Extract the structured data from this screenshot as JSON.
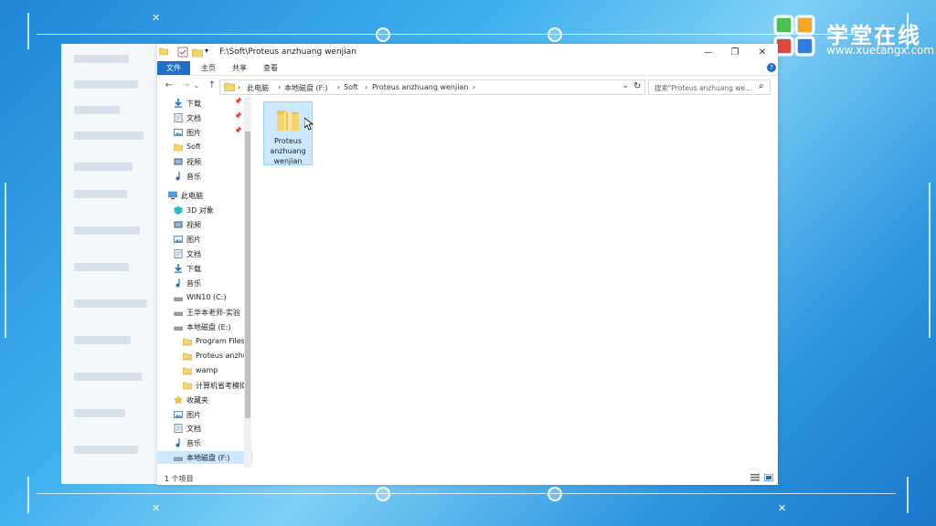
{
  "logo": {
    "name": "学堂在线",
    "url": "www.xuetangx.com"
  },
  "window": {
    "title_path": "F:\\Soft\\Proteus anzhuang  wenjian",
    "controls": {
      "minimize": "—",
      "maximize": "❐",
      "close": "✕"
    },
    "ribbon_tabs": [
      "文件",
      "主页",
      "共享",
      "查看"
    ],
    "help": "?",
    "nav": {
      "back": "←",
      "forward": "→",
      "recent": "⌄",
      "up": "↑",
      "dropdown": "⌄",
      "refresh": "↻"
    },
    "address": {
      "crumbs": [
        "此电脑",
        "本地磁盘 (F:)",
        "Soft",
        "Proteus anzhuang  wenjian"
      ],
      "sep": "›"
    },
    "search": {
      "placeholder": "搜索\"Proteus anzhuang  we...",
      "icon": "⌕"
    },
    "sidebar": [
      {
        "label": "下载",
        "icon": "download-icon",
        "pinned": true
      },
      {
        "label": "文档",
        "icon": "document-icon",
        "pinned": true
      },
      {
        "label": "图片",
        "icon": "picture-icon",
        "pinned": true
      },
      {
        "label": "Soft",
        "icon": "folder-icon",
        "pinned": false
      },
      {
        "label": "视频",
        "icon": "video-icon",
        "pinned": false
      },
      {
        "label": "音乐",
        "icon": "music-icon",
        "pinned": false
      },
      {
        "label": "此电脑",
        "icon": "pc-icon",
        "pinned": false
      },
      {
        "label": "3D 对象",
        "icon": "cube-icon",
        "pinned": false
      },
      {
        "label": "视频",
        "icon": "video-icon",
        "pinned": false
      },
      {
        "label": "图片",
        "icon": "picture-icon",
        "pinned": false
      },
      {
        "label": "文档",
        "icon": "document-icon",
        "pinned": false
      },
      {
        "label": "下载",
        "icon": "download-icon",
        "pinned": false
      },
      {
        "label": "音乐",
        "icon": "music-icon",
        "pinned": false
      },
      {
        "label": "WIN10 (C:)",
        "icon": "drive-icon",
        "pinned": false
      },
      {
        "label": "王华本老师-实验",
        "icon": "drive-icon",
        "pinned": false
      },
      {
        "label": "本地磁盘 (E:)",
        "icon": "drive-icon",
        "pinned": false
      },
      {
        "label": "Program Files",
        "icon": "folder-icon",
        "pinned": false
      },
      {
        "label": "Proteus anzhu",
        "icon": "folder-icon",
        "pinned": false
      },
      {
        "label": "wamp",
        "icon": "folder-icon",
        "pinned": false
      },
      {
        "label": "计算机省考模拟",
        "icon": "folder-icon",
        "pinned": false
      },
      {
        "label": "收藏夹",
        "icon": "star-icon",
        "pinned": false
      },
      {
        "label": "图片",
        "icon": "picture-icon",
        "pinned": false
      },
      {
        "label": "文档",
        "icon": "document-icon",
        "pinned": false
      },
      {
        "label": "音乐",
        "icon": "music-icon",
        "pinned": false
      },
      {
        "label": "本地磁盘 (F:)",
        "icon": "drive-icon",
        "pinned": false
      }
    ],
    "files": [
      {
        "name": "Proteus anzhuang wenjian",
        "type": "folder",
        "selected": true
      }
    ],
    "status": {
      "count": "1 个项目"
    }
  },
  "colors": {
    "accent": "#1e6fc8",
    "selection": "#cce8ff",
    "folder": "#f6d36b"
  }
}
